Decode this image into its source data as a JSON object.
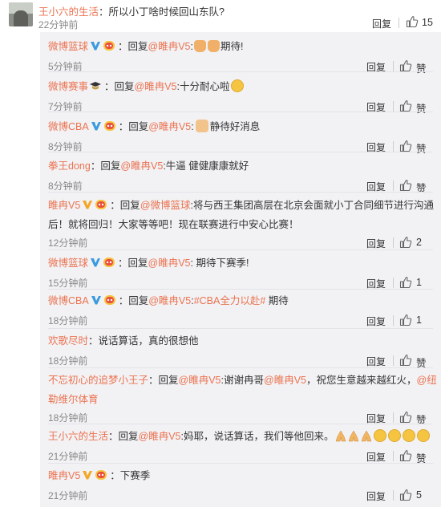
{
  "top_comment": {
    "user": "王小六的生活",
    "colon": "：",
    "text": "所以小丁啥时候回山东队?",
    "time": "22分钟前",
    "reply_label": "回复",
    "likes": "15"
  },
  "replies": [
    {
      "user": "微博篮球",
      "pre": "：回复",
      "at": "@睢冉V5",
      "post": ":",
      "tail": "期待!",
      "time": "5分钟前",
      "reply_label": "回复",
      "like_label": "赞"
    },
    {
      "user": "微博赛事",
      "pre": "：回复",
      "at": "@睢冉V5",
      "post": ":十分耐心啦",
      "tail": "",
      "time": "7分钟前",
      "reply_label": "回复",
      "like_label": "赞"
    },
    {
      "user": "微博CBA",
      "pre": "：回复",
      "at": "@睢冉V5",
      "post": ":",
      "tail": "静待好消息",
      "time": "8分钟前",
      "reply_label": "回复",
      "like_label": "赞"
    },
    {
      "user": "拳王dong",
      "pre": "：回复",
      "at": "@睢冉V5",
      "post": ":牛逼 健健康康就好",
      "tail": "",
      "time": "8分钟前",
      "reply_label": "回复",
      "like_label": "赞"
    },
    {
      "user": "睢冉V5",
      "pre": "：回复",
      "at": "@微博篮球",
      "post": ":将与西王集团高层在北京会面就小丁合同细节进行沟通后！就将回归！大家等等吧！现在联赛进行中安心比赛！",
      "tail": "",
      "time": "12分钟前",
      "reply_label": "回复",
      "like_label": "2"
    },
    {
      "user": "微博篮球",
      "pre": "：回复",
      "at": "@睢冉V5",
      "post": ": 期待下赛季!",
      "tail": "",
      "time": "15分钟前",
      "reply_label": "回复",
      "like_label": "1"
    },
    {
      "user": "微博CBA",
      "pre": "：回复",
      "at": "@睢冉V5",
      "post": ":",
      "at2": "#CBA全力以赴#",
      "tail": " 期待",
      "time": "18分钟前",
      "reply_label": "回复",
      "like_label": "1"
    },
    {
      "user": "欢歌尽时",
      "pre": "：说话算话，真的很想他",
      "at": "",
      "post": "",
      "tail": "",
      "time": "18分钟前",
      "reply_label": "回复",
      "like_label": "赞"
    },
    {
      "user": "不忘初心的追梦小王子",
      "pre": "：回复",
      "at": "@睢冉V5",
      "post": ":谢谢冉哥",
      "at2": "@睢冉V5",
      "mid": "，祝您生意越来越红火，",
      "at3": "@纽勒维尔体育",
      "tail": "",
      "time": "18分钟前",
      "reply_label": "回复",
      "like_label": "赞"
    },
    {
      "user": "王小六的生活",
      "pre": "：回复",
      "at": "@睢冉V5",
      "post": ":妈耶，说话算话，我们等他回来。",
      "tail": "",
      "time": "21分钟前",
      "reply_label": "回复",
      "like_label": "赞"
    },
    {
      "user": "睢冉V5",
      "pre": "：下赛季",
      "at": "",
      "post": "",
      "tail": "",
      "time": "21分钟前",
      "reply_label": "回复",
      "like_label": "5"
    }
  ]
}
